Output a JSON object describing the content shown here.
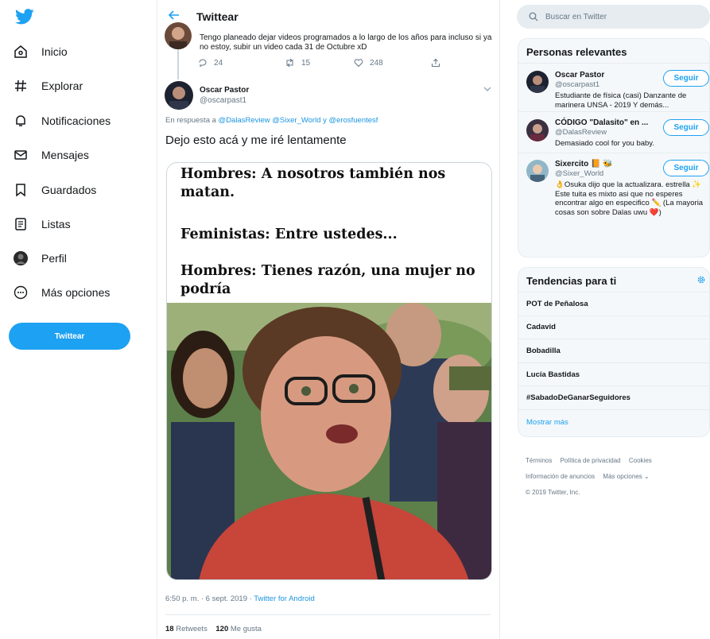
{
  "sidebar": {
    "items": [
      {
        "label": "Inicio",
        "icon": "home-icon"
      },
      {
        "label": "Explorar",
        "icon": "hashtag-icon"
      },
      {
        "label": "Notificaciones",
        "icon": "bell-icon"
      },
      {
        "label": "Mensajes",
        "icon": "envelope-icon"
      },
      {
        "label": "Guardados",
        "icon": "bookmark-icon"
      },
      {
        "label": "Listas",
        "icon": "list-icon"
      },
      {
        "label": "Perfil",
        "icon": "profile-icon"
      },
      {
        "label": "Más opciones",
        "icon": "more-circle-icon"
      }
    ],
    "tweet_button": "Twittear"
  },
  "header": {
    "title": "Twittear"
  },
  "previous_tweet": {
    "text": "Tengo planeado dejar videos programados a lo largo de los años para incluso si ya no estoy, subir un video cada 31 de Octubre xD",
    "replies": "24",
    "retweets": "15",
    "likes": "248"
  },
  "tweet": {
    "author_name": "Oscar Pastor",
    "author_handle": "@oscarpast1",
    "reply_prefix": "En respuesta a",
    "reply_to": "@DalasReview @Sixer_World y @erosfuentesf",
    "text": "Dejo esto acá y me iré lentamente",
    "meme_lines": [
      "Hombres: A nosotros también nos matan.",
      "Feministas: Entre ustedes...",
      "Hombres: Tienes razón, una mujer no podría"
    ],
    "time": "6:50 p. m. · 6 sept. 2019 ·",
    "source": "Twitter for Android",
    "retweets_count": "18",
    "retweets_label": "Retweets",
    "likes_count": "120",
    "likes_label": "Me gusta"
  },
  "search": {
    "placeholder": "Buscar en Twitter"
  },
  "relevant": {
    "title": "Personas relevantes",
    "follow_label": "Seguir",
    "people": [
      {
        "name": "Oscar Pastor",
        "handle": "@oscarpast1",
        "bio": "Estudiante de física (casi) Danzante de marinera UNSA - 2019 Y demás..."
      },
      {
        "name": "CÓDIGO \"Dalasito\" en ...",
        "handle": "@DalasReview",
        "bio": "Demasiado cool for you baby."
      },
      {
        "name": "Sixercito 📙 🐝",
        "handle": "@Sixer_World",
        "bio": "👌Osuka dijo que la actualizara. estrella ✨ Este tuita es mixto asi que no esperes encontrar algo en especifico ✏️ (La mayoria cosas son sobre Dalas uwu ❤️)"
      }
    ]
  },
  "trends": {
    "title": "Tendencias para ti",
    "items": [
      "POT de Peñalosa",
      "Cadavid",
      "Bobadilla",
      "Lucía Bastidas",
      "#SabadoDeGanarSeguidores"
    ],
    "show_more": "Mostrar más"
  },
  "footer": {
    "links": [
      "Términos",
      "Política de privacidad",
      "Cookies",
      "Información de anuncios",
      "Más opciones ⌄"
    ],
    "copyright": "© 2019 Twitter, Inc."
  },
  "colors": {
    "accent": "#1da1f2",
    "text": "#14171a",
    "muted": "#657786",
    "border": "#e6ecf0"
  }
}
